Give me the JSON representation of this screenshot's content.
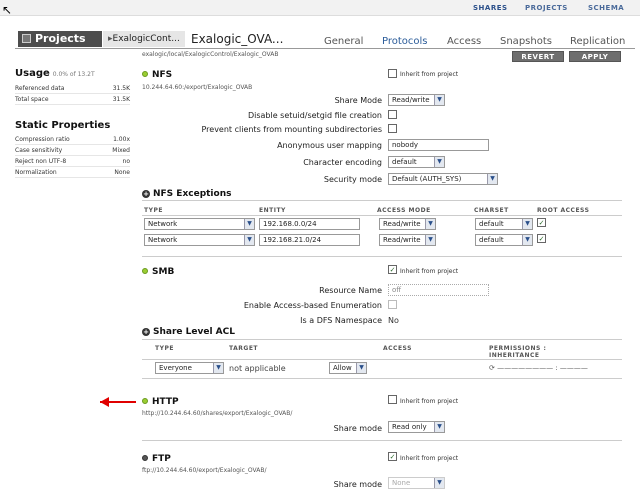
{
  "topnav": {
    "shares": "SHARES",
    "projects": "PROJECTS",
    "schema": "SCHEMA"
  },
  "header": {
    "projects_label": "Projects",
    "crumb_parent": "ExalogicCont...",
    "crumb_current": "Exalogic_OVA...",
    "tabs": [
      "General",
      "Protocols",
      "Access",
      "Snapshots",
      "Replication"
    ],
    "path": "exalogic/local/ExalogicControl/Exalogic_OVAB",
    "revert": "REVERT",
    "apply": "APPLY"
  },
  "usage": {
    "title": "Usage",
    "pct": "0.0% of 13.2T",
    "rows": [
      {
        "label": "Referenced data",
        "value": "31.5K"
      },
      {
        "label": "Total space",
        "value": "31.5K"
      }
    ]
  },
  "static": {
    "title": "Static Properties",
    "rows": [
      {
        "label": "Compression ratio",
        "value": "1.00x"
      },
      {
        "label": "Case sensitivity",
        "value": "Mixed"
      },
      {
        "label": "Reject non UTF-8",
        "value": "no"
      },
      {
        "label": "Normalization",
        "value": "None"
      }
    ]
  },
  "nfs": {
    "title": "NFS",
    "url": "10.244.64.60:/export/Exalogic_OVAB",
    "inherit": "Inherit from project",
    "share_mode_label": "Share Mode",
    "share_mode": "Read/write",
    "setuid_label": "Disable setuid/setgid file creation",
    "prevent_label": "Prevent clients from mounting subdirectories",
    "anon_label": "Anonymous user mapping",
    "anon_value": "nobody",
    "charenc_label": "Character encoding",
    "charenc_value": "default",
    "secmode_label": "Security mode",
    "secmode_value": "Default (AUTH_SYS)"
  },
  "exceptions": {
    "title": "NFS Exceptions",
    "cols": [
      "TYPE",
      "ENTITY",
      "ACCESS MODE",
      "CHARSET",
      "ROOT ACCESS"
    ],
    "rows": [
      {
        "type": "Network",
        "entity": "192.168.0.0/24",
        "mode": "Read/write",
        "charset": "default",
        "root": "✓"
      },
      {
        "type": "Network",
        "entity": "192.168.21.0/24",
        "mode": "Read/write",
        "charset": "default",
        "root": "✓"
      }
    ]
  },
  "smb": {
    "title": "SMB",
    "inherit": "Inherit from project",
    "resource_label": "Resource Name",
    "resource_value": "off",
    "abe_label": "Enable Access-based Enumeration",
    "dfs_label": "Is a DFS Namespace",
    "dfs_value": "No"
  },
  "acl": {
    "title": "Share Level ACL",
    "cols": [
      "TYPE",
      "TARGET",
      "ACCESS",
      "PERMISSIONS :",
      "INHERITANCE"
    ],
    "type": "Everyone",
    "target": "not applicable",
    "access": "Allow",
    "perms": "⟳ ———————— : ————"
  },
  "http": {
    "title": "HTTP",
    "inherit": "Inherit from project",
    "url": "http://10.244.64.60/shares/export/Exalogic_OVAB/",
    "share_mode_label": "Share mode",
    "share_mode": "Read only"
  },
  "ftp": {
    "title": "FTP",
    "inherit": "Inherit from project",
    "url": "ftp://10.244.64.60/export/Exalogic_OVAB/",
    "share_mode_label": "Share mode",
    "share_mode": "None"
  },
  "colors": {
    "accent": "#2b5c99",
    "status_green": "#9acd32",
    "arrow": "#e00000"
  }
}
